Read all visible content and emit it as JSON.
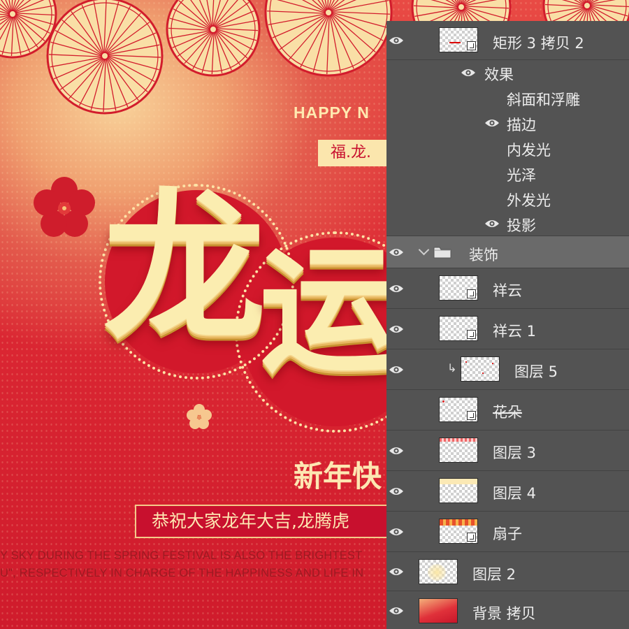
{
  "poster": {
    "happy_text": "HAPPY N",
    "tagline_box": "福.龙.",
    "big_char_1": "龙",
    "big_char_2": "运",
    "xinnian": "新年快",
    "greeting": "恭祝大家龙年大吉,龙腾虎",
    "english_line_1": "Y SKY DURING THE SPRING FESTIVAL IS ALSO THE BRIGHTEST",
    "english_line_2": "U\", RESPECTIVELY IN CHARGE OF THE HAPPINESS AND LIFE IN",
    "colors": {
      "red": "#d2182b",
      "cream": "#fbedb0",
      "gold": "#f4c989"
    }
  },
  "layers_panel": {
    "top_layer": {
      "name": "矩形 3 拷贝 2",
      "visible": true
    },
    "effects_label": "效果",
    "effects": [
      {
        "name": "斜面和浮雕",
        "visible": false
      },
      {
        "name": "描边",
        "visible": true
      },
      {
        "name": "内发光",
        "visible": false
      },
      {
        "name": "光泽",
        "visible": false
      },
      {
        "name": "外发光",
        "visible": false
      },
      {
        "name": "投影",
        "visible": true
      }
    ],
    "group": {
      "name": "装饰",
      "expanded": true,
      "visible": true
    },
    "layers": [
      {
        "name": "祥云",
        "visible": true,
        "smart_object": true
      },
      {
        "name": "祥云 1",
        "visible": true,
        "smart_object": true
      },
      {
        "name": "图层 5",
        "visible": true,
        "clipped": true
      },
      {
        "name": "花朵",
        "visible": false,
        "smart_object": true
      },
      {
        "name": "图层 3",
        "visible": true
      },
      {
        "name": "图层 4",
        "visible": true
      },
      {
        "name": "扇子",
        "visible": true,
        "smart_object": true
      },
      {
        "name": "图层 2",
        "visible": true
      },
      {
        "name": "背景 拷贝",
        "visible": true
      }
    ]
  }
}
